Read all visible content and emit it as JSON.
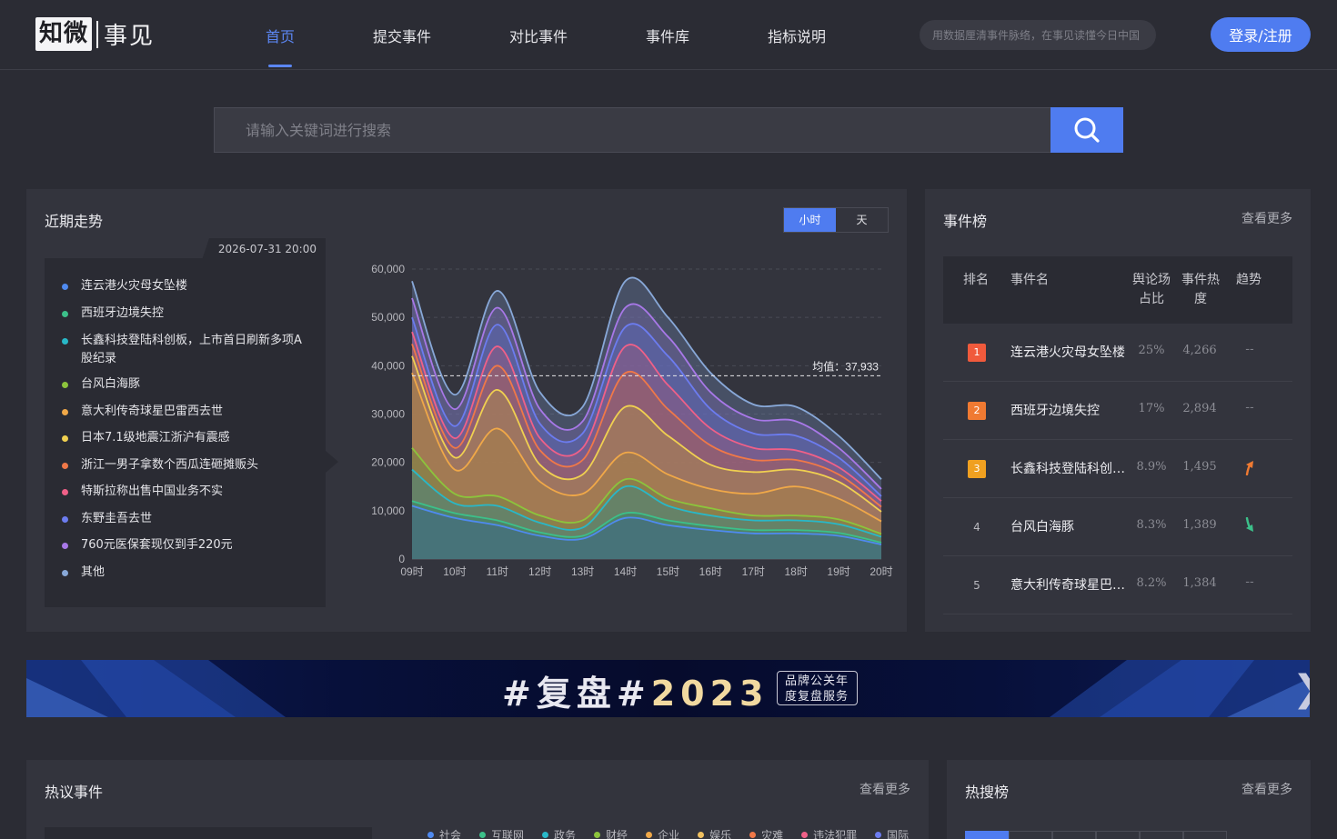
{
  "logo": {
    "part1": "知微",
    "part2": "事见"
  },
  "nav": {
    "items": [
      "首页",
      "提交事件",
      "对比事件",
      "事件库",
      "指标说明"
    ],
    "search_placeholder": "用数据厘清事件脉络，在事见读懂今日中国",
    "login_label": "登录/注册"
  },
  "search": {
    "placeholder": "请输入关键词进行搜索"
  },
  "trend": {
    "title": "近期走势",
    "toggle": [
      "小时",
      "天"
    ],
    "timestamp": "2026-07-31 20:00",
    "legend": [
      {
        "label": "连云港火灾母女坠楼",
        "color": "#4f8af0"
      },
      {
        "label": "西班牙边境失控",
        "color": "#3cc08a"
      },
      {
        "label": "长鑫科技登陆科创板，上市首日刷新多项A股纪录",
        "color": "#28b8c8"
      },
      {
        "label": "台风白海豚",
        "color": "#8cc43c"
      },
      {
        "label": "意大利传奇球星巴雷西去世",
        "color": "#f0a848"
      },
      {
        "label": "日本7.1级地震江浙沪有震感",
        "color": "#f0d050"
      },
      {
        "label": "浙江一男子拿数个西瓜连砸摊贩头",
        "color": "#f07848"
      },
      {
        "label": "特斯拉称出售中国业务不实",
        "color": "#f06088"
      },
      {
        "label": "东野圭吾去世",
        "color": "#6c7cf0"
      },
      {
        "label": "760元医保套现仅到手220元",
        "color": "#a878e8"
      },
      {
        "label": "其他",
        "color": "#88a8d8"
      }
    ]
  },
  "chart_data": {
    "type": "area",
    "x": [
      "09时",
      "10时",
      "11时",
      "12时",
      "13时",
      "14时",
      "15时",
      "16时",
      "17时",
      "18时",
      "19时",
      "20时"
    ],
    "ylim": [
      0,
      60000
    ],
    "yticks": [
      "0",
      "10,000",
      "20,000",
      "30,000",
      "40,000",
      "50,000",
      "60,000"
    ],
    "average_label": "均值：37,933",
    "average_value": 37933,
    "stacked_totals": [
      57500,
      34000,
      55500,
      34500,
      31500,
      57500,
      50000,
      38500,
      32000,
      31500,
      25500,
      16500
    ],
    "series_tops": [
      [
        57500,
        34000,
        55500,
        34500,
        31500,
        57500,
        50000,
        38500,
        32000,
        31500,
        25500,
        16500
      ],
      [
        54000,
        31000,
        52000,
        31000,
        28500,
        52000,
        46000,
        34500,
        29000,
        28500,
        23000,
        14500
      ],
      [
        50000,
        27500,
        48500,
        28000,
        26000,
        48000,
        42000,
        31000,
        26000,
        25500,
        21000,
        13000
      ],
      [
        47000,
        25000,
        44000,
        25000,
        23000,
        44000,
        36000,
        27000,
        23000,
        22500,
        19000,
        12000
      ],
      [
        44500,
        23000,
        40000,
        22500,
        20500,
        38500,
        31000,
        23500,
        20500,
        20500,
        17500,
        10800
      ],
      [
        42000,
        21000,
        35000,
        19500,
        17500,
        31500,
        25500,
        19500,
        18000,
        18500,
        16000,
        9800
      ],
      [
        38500,
        18500,
        27000,
        16000,
        13500,
        22000,
        17500,
        14500,
        13500,
        15000,
        12500,
        7800
      ],
      [
        23000,
        13500,
        13000,
        9000,
        8000,
        16500,
        12500,
        10500,
        9000,
        9000,
        8200,
        5200
      ],
      [
        18500,
        11500,
        11000,
        7500,
        6500,
        15000,
        11000,
        9000,
        8000,
        8000,
        7200,
        4600
      ],
      [
        12000,
        9500,
        8000,
        5500,
        4800,
        9500,
        8000,
        6800,
        6000,
        6000,
        5400,
        3400
      ],
      [
        11000,
        8500,
        7000,
        4800,
        4200,
        8500,
        7000,
        6000,
        5300,
        5300,
        4800,
        3000
      ]
    ]
  },
  "events": {
    "title": "事件榜",
    "more": "查看更多",
    "headers": {
      "rank": "排名",
      "name": "事件名",
      "share_a": "舆论场",
      "share_b": "占比",
      "heat_a": "事件热",
      "heat_b": "度",
      "trend": "趋势"
    },
    "rows": [
      {
        "rank": "1",
        "name": "连云港火灾母女坠楼",
        "share": "25%",
        "heat": "4,266",
        "trend": "--",
        "badge": "#f05a3c"
      },
      {
        "rank": "2",
        "name": "西班牙边境失控",
        "share": "17%",
        "heat": "2,894",
        "trend": "--",
        "badge": "#f07a32"
      },
      {
        "rank": "3",
        "name": "长鑫科技登陆科创板，上市首日刷新多项A股纪录",
        "share": "8.9%",
        "heat": "1,495",
        "trend": "up",
        "badge": "#f0a020"
      },
      {
        "rank": "4",
        "name": "台风白海豚",
        "share": "8.3%",
        "heat": "1,389",
        "trend": "down",
        "badge": ""
      },
      {
        "rank": "5",
        "name": "意大利传奇球星巴雷西去世",
        "share": "8.2%",
        "heat": "1,384",
        "trend": "--",
        "badge": ""
      }
    ]
  },
  "banner": {
    "hashtag": "#复盘#",
    "year": "2023",
    "tag_line1": "品牌公关年",
    "tag_line2": "度复盘服务"
  },
  "hot": {
    "title": "热议事件",
    "more": "查看更多",
    "categories": [
      {
        "label": "社会",
        "color": "#4f8af0"
      },
      {
        "label": "互联网",
        "color": "#3cc08a"
      },
      {
        "label": "政务",
        "color": "#28b8c8"
      },
      {
        "label": "财经",
        "color": "#8cc43c"
      },
      {
        "label": "企业",
        "color": "#f0a848"
      },
      {
        "label": "娱乐",
        "color": "#f0c060"
      },
      {
        "label": "灾难",
        "color": "#f07848"
      },
      {
        "label": "违法犯罪",
        "color": "#f06088"
      },
      {
        "label": "国际",
        "color": "#6c7cf0"
      }
    ]
  },
  "hotsearch": {
    "title": "热搜榜",
    "more": "查看更多"
  }
}
